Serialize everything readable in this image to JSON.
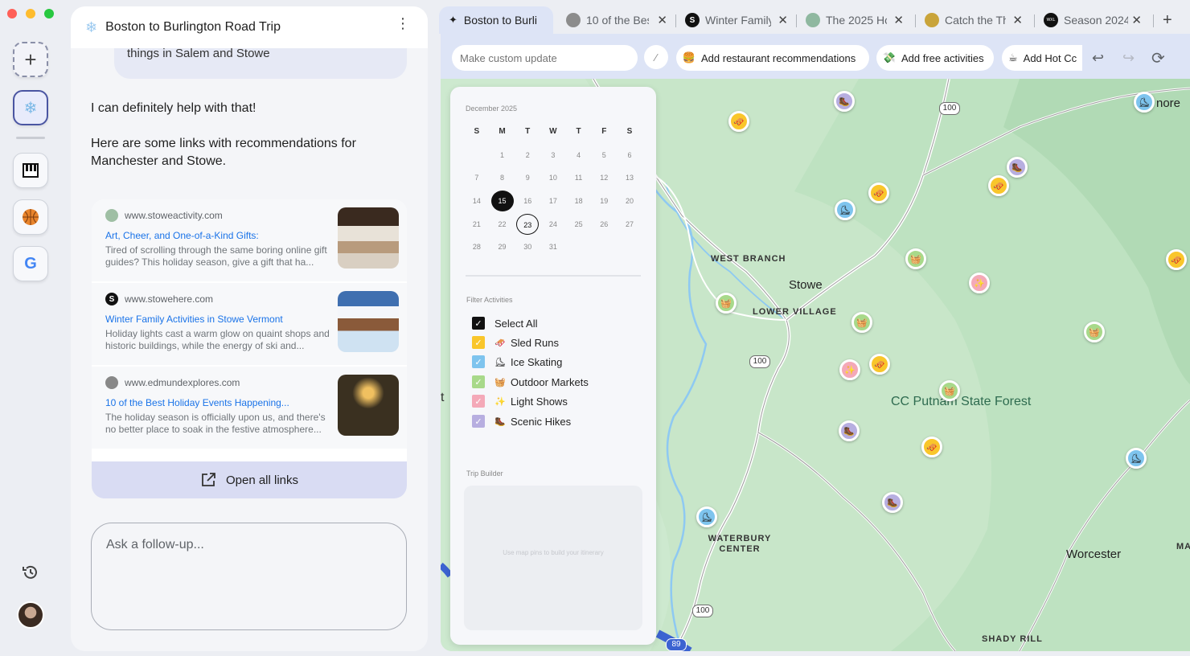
{
  "rail": {
    "new_label": "+"
  },
  "chat": {
    "title": "Boston to Burlington Road Trip",
    "user_message_tail": "things in Salem and Stowe",
    "assistant_line1": "I can definitely help with that!",
    "assistant_line2": "Here are some links with recommendations for Manchester and Stowe.",
    "links": [
      {
        "site": "www.stoweactivity.com",
        "title": "Art, Cheer, and One-of-a-Kind Gifts:",
        "desc": "Tired of scrolling through the same boring online gift guides? This holiday season, give a gift that ha..."
      },
      {
        "site": "www.stowehere.com",
        "site_letter": "S",
        "title": "Winter Family Activities in Stowe Vermont",
        "desc": "Holiday lights cast a warm glow on quaint shops and historic buildings, while the energy of ski and..."
      },
      {
        "site": "www.edmundexplores.com",
        "title": "10 of the Best Holiday Events Happening...",
        "desc": "The holiday season is officially upon us, and there's no better place to soak in the festive atmosphere..."
      }
    ],
    "open_all_label": "Open all links",
    "followup_placeholder": "Ask a follow-up..."
  },
  "tabs": [
    {
      "label": "Boston to Burli",
      "active": true
    },
    {
      "label": "10 of the Bes"
    },
    {
      "label": "Winter Family",
      "icon_letter": "S"
    },
    {
      "label": "The 2025 Ho"
    },
    {
      "label": "Catch the Th"
    },
    {
      "label": "Season 2024",
      "icon_letter": "WXL"
    }
  ],
  "new_tab_label": "+",
  "toolbar": {
    "custom_update_placeholder": "Make custom update",
    "chips": [
      {
        "label": "Add restaurant recommendations",
        "emoji": "🍔"
      },
      {
        "label": "Add free activities",
        "emoji": "💸"
      },
      {
        "label": "Add Hot Cc",
        "emoji": "☕"
      }
    ]
  },
  "calendar": {
    "month": "December 2025",
    "weekdays": [
      "S",
      "M",
      "T",
      "W",
      "T",
      "F",
      "S"
    ],
    "weeks": [
      [
        "",
        "1",
        "2",
        "3",
        "4",
        "5",
        "6"
      ],
      [
        "7",
        "8",
        "9",
        "10",
        "11",
        "12",
        "13"
      ],
      [
        "14",
        "15",
        "16",
        "17",
        "18",
        "19",
        "20"
      ],
      [
        "21",
        "22",
        "23",
        "24",
        "25",
        "26",
        "27"
      ],
      [
        "28",
        "29",
        "30",
        "31",
        "",
        "",
        ""
      ]
    ],
    "selected_day": "15",
    "highlighted_day": "23"
  },
  "filters": {
    "title": "Filter Activities",
    "items": [
      {
        "label": "Select All",
        "emoji": "",
        "color": "#111111",
        "checked": true
      },
      {
        "label": "Sled Runs",
        "emoji": "🛷",
        "color": "#f9c62b",
        "checked": true
      },
      {
        "label": "Ice Skating",
        "emoji": "⛸",
        "color": "#7ec4ee",
        "checked": true
      },
      {
        "label": "Outdoor Markets",
        "emoji": "🧺",
        "color": "#a8d98a",
        "checked": true
      },
      {
        "label": "Light Shows",
        "emoji": "✨",
        "color": "#f4a9b8",
        "checked": true
      },
      {
        "label": "Scenic Hikes",
        "emoji": "🥾",
        "color": "#b7aee0",
        "checked": true
      }
    ]
  },
  "trip_builder": {
    "title": "Trip Builder",
    "hint": "Use map pins to build your itinerary"
  },
  "map": {
    "labels": {
      "west_branch": "WEST BRANCH",
      "stowe": "Stowe",
      "lower_village": "LOWER VILLAGE",
      "cc_putnam": "CC Putnam State Forest",
      "waterbury_center": "WATERBURY CENTER",
      "worcester": "Worcester",
      "shady_rill": "SHADY RILL",
      "more": "nore",
      "ma": "MA",
      "t": "t"
    },
    "shields": [
      "100",
      "100",
      "100",
      "89"
    ],
    "pin_colors": {
      "sled": "#f9c62b",
      "skate": "#7ec4ee",
      "market": "#a8d98a",
      "light": "#f4a9b8",
      "hike": "#b7aee0"
    }
  }
}
